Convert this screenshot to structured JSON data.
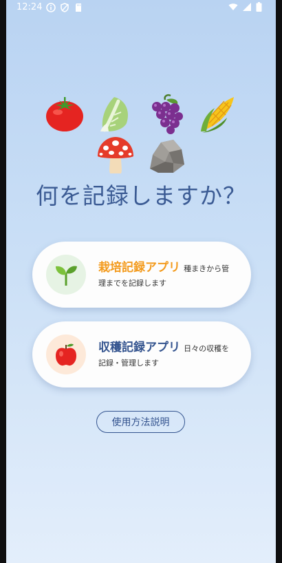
{
  "status": {
    "time": "12:24"
  },
  "emojis": [
    "tomato-icon",
    "lettuce-icon",
    "grapes-icon",
    "corn-icon",
    "mushroom-icon",
    "rock-icon"
  ],
  "headline": "何を記録しますか？",
  "cards": [
    {
      "title": "栽培記録アプリ",
      "desc": "種まきから管理までを記録します",
      "icon": "seedling-icon",
      "accent": "#f39a1c"
    },
    {
      "title": "収穫記録アプリ",
      "desc": "日々の収穫を記録・管理します",
      "icon": "apple-icon",
      "accent": "#33538e"
    }
  ],
  "howto_label": "使用方法説明"
}
